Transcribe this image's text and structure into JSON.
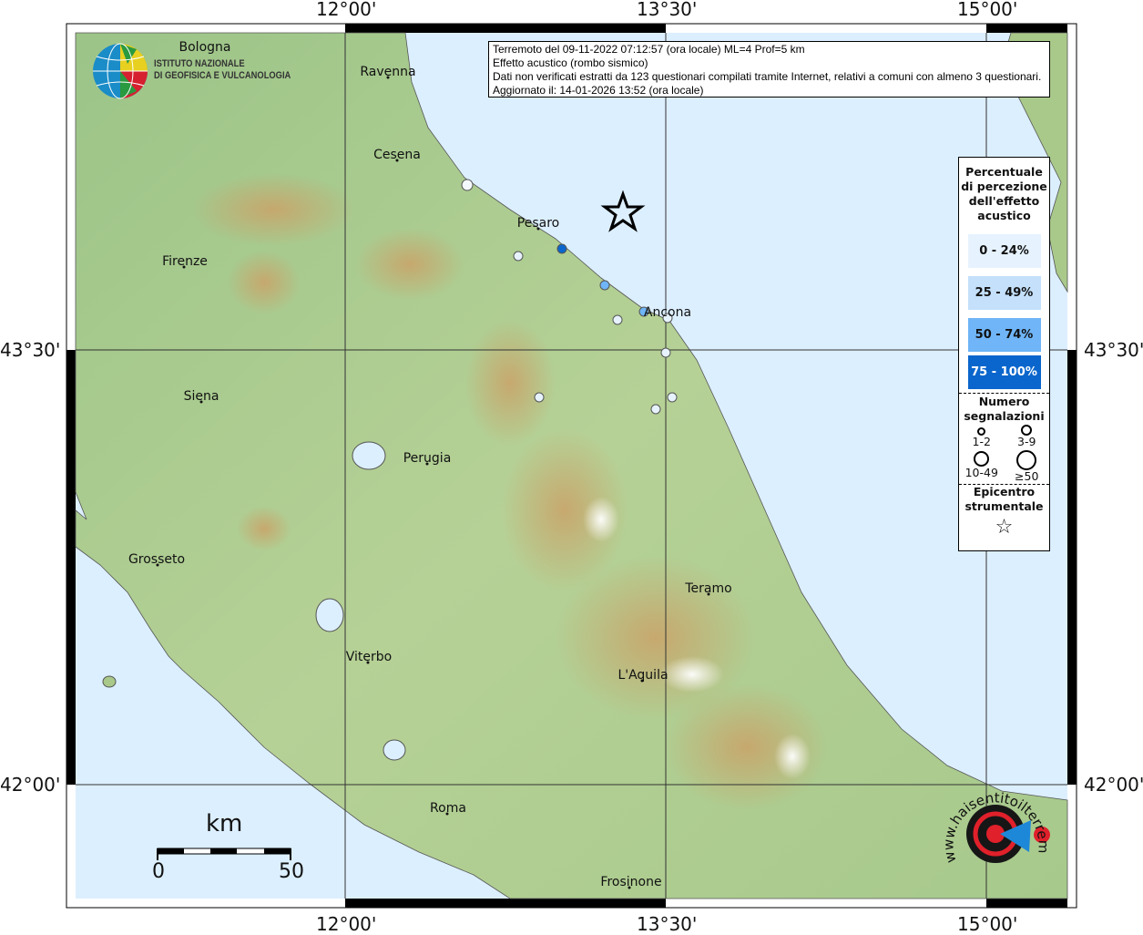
{
  "info": {
    "line1": "Terremoto del 09-11-2022 07:12:57 (ora locale) ML=4 Prof=5 km",
    "line2": "Effetto acustico (rombo sismico)",
    "line3": "Dati non verificati estratti da 123 questionari compilati tramite Internet, relativi a comuni con almeno 3 questionari.",
    "line4": "Aggiornato il: 14-01-2026 13:52 (ora locale)"
  },
  "axes": {
    "lon": [
      "12°00'",
      "13°30'",
      "15°00'"
    ],
    "lat": [
      "43°30'",
      "42°00'"
    ]
  },
  "cities": [
    "Bologna",
    "Ravenna",
    "Cesena",
    "Pesaro",
    "Firenze",
    "Ancona",
    "Siena",
    "Perugia",
    "Grosseto",
    "Teramo",
    "Viterbo",
    "L'Aquila",
    "Roma",
    "Frosinone"
  ],
  "logo": {
    "ingv_line1": "ISTITUTO NAZIONALE",
    "ingv_line2": "DI GEOFISICA E VULCANOLOGIA",
    "hsit": "www.haisentitoilterremoto.it"
  },
  "legend": {
    "title": "Percentuale di percezione dell'effetto acustico",
    "classes": [
      {
        "label": "0 - 24%",
        "color": "#e6f3ff"
      },
      {
        "label": "25 - 49%",
        "color": "#c4e0fb"
      },
      {
        "label": "50 - 74%",
        "color": "#6fb5f7"
      },
      {
        "label": "75 - 100%",
        "color": "#0a66cc"
      }
    ],
    "count_title": "Numero segnalazioni",
    "counts": [
      "1-2",
      "3-9",
      "10-49",
      "≥50"
    ],
    "epicenter_title": "Epicentro strumentale"
  },
  "scale": {
    "unit": "km",
    "min": "0",
    "max": "50"
  },
  "colors": {
    "sea": "#dcefff",
    "land": "#a9cc8c"
  }
}
